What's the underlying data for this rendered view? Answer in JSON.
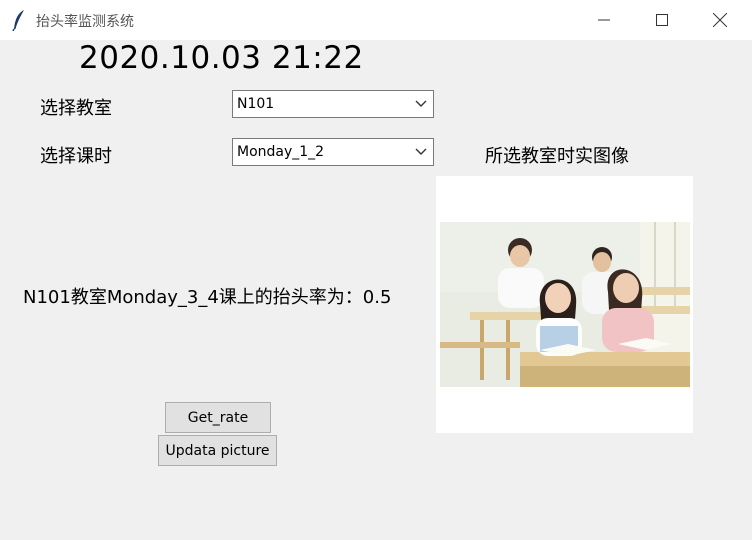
{
  "window": {
    "title": "抬头率监测系统",
    "icon": "feather-icon",
    "controls": [
      "minimize-icon",
      "maximize-icon",
      "close-icon"
    ]
  },
  "clock": "2020.10.03 21:22",
  "classroom": {
    "label": "选择教室",
    "value": "N101"
  },
  "lesson": {
    "label": "选择课时",
    "value": "Monday_1_2"
  },
  "image_caption": "所选教室时实图像",
  "rate_result": "N101教室Monday_3_4课上的抬头率为：0.5",
  "buttons": {
    "get_rate": "Get_rate",
    "update_picture": "Updata picture"
  }
}
